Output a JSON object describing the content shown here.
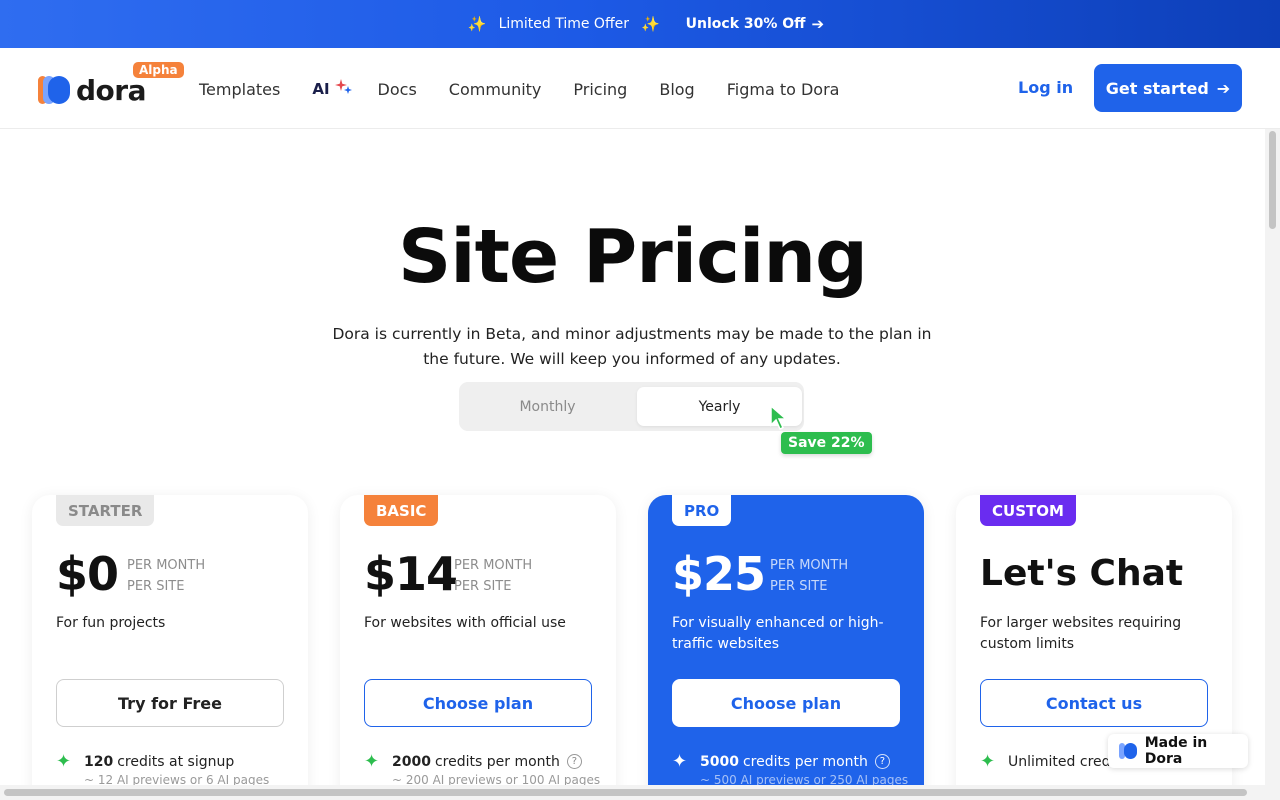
{
  "promo": {
    "offer_text": "Limited Time Offer",
    "unlock_text": "Unlock 30% Off"
  },
  "nav": {
    "brand": "dora",
    "badge": "Alpha",
    "links": [
      "Templates",
      "AI",
      "Docs",
      "Community",
      "Pricing",
      "Blog",
      "Figma to Dora"
    ],
    "login": "Log in",
    "cta": "Get started"
  },
  "hero": {
    "title": "Site Pricing",
    "subtitle": "Dora is currently in Beta, and minor adjustments may be made to the plan in the future. We will keep you informed of any updates."
  },
  "billing_toggle": {
    "monthly": "Monthly",
    "yearly": "Yearly",
    "selected": "Yearly",
    "save_badge": "Save 22%"
  },
  "plans": [
    {
      "tag": "STARTER",
      "price": "$0",
      "per_line1": "PER MONTH",
      "per_line2": "PER SITE",
      "description": "For fun projects",
      "button": "Try for Free",
      "feature_bold": "120",
      "feature_text": "credits at signup",
      "feature_sub": "~ 12 AI previews or 6 AI pages"
    },
    {
      "tag": "BASIC",
      "price": "$14",
      "per_line1": "PER MONTH",
      "per_line2": "PER SITE",
      "description": "For websites with official use",
      "button": "Choose plan",
      "feature_bold": "2000",
      "feature_text": "credits per month",
      "feature_sub": "~ 200 AI previews or 100 AI pages"
    },
    {
      "tag": "PRO",
      "price": "$25",
      "per_line1": "PER MONTH",
      "per_line2": "PER SITE",
      "description": "For visually enhanced or high-traffic websites",
      "button": "Choose plan",
      "feature_bold": "5000",
      "feature_text": "credits per month",
      "feature_sub": "~ 500 AI previews or 250 AI pages"
    },
    {
      "tag": "CUSTOM",
      "price": "Let's Chat",
      "description": "For larger websites requiring custom limits",
      "button": "Contact us",
      "feature_text": "Unlimited cred"
    }
  ],
  "made_in": "Made in Dora",
  "colors": {
    "primary": "#1f63ea",
    "alpha_badge": "#f5823b",
    "basic_tag": "#f5823b",
    "custom_tag": "#6a2cf0",
    "starter_tag": "#e9e9e9",
    "success": "#2dbd4e"
  }
}
